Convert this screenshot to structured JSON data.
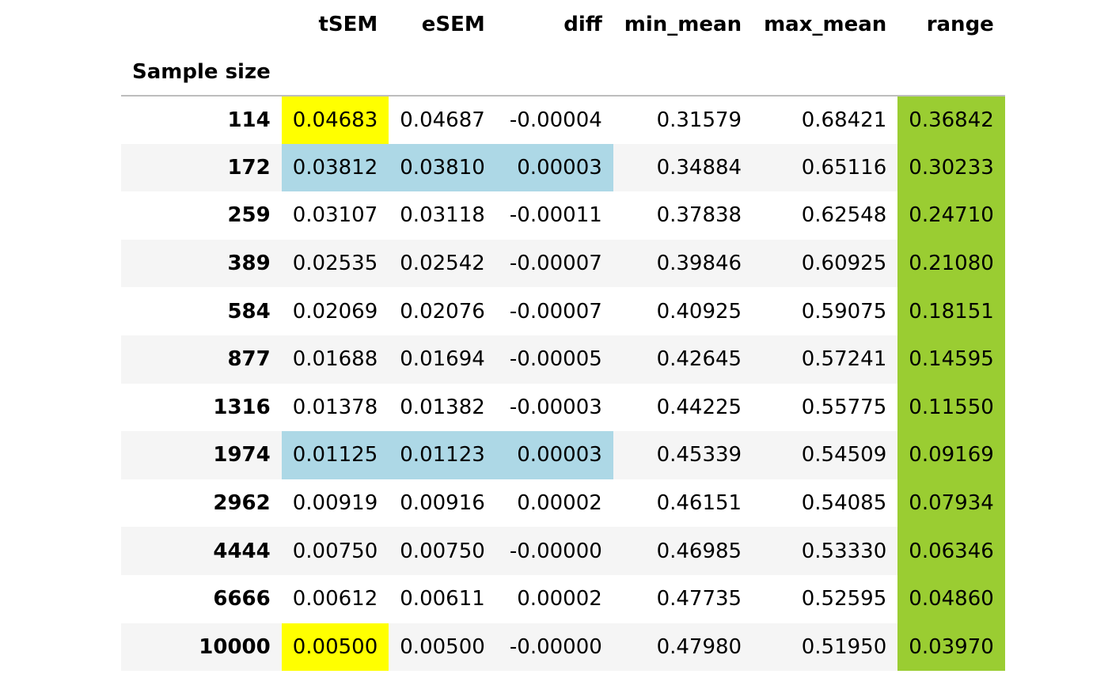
{
  "table": {
    "index_name": "Sample size",
    "columns": [
      "tSEM",
      "eSEM",
      "diff",
      "min_mean",
      "max_mean",
      "range"
    ],
    "highlight_colors": {
      "yellow": "#ffff00",
      "blue": "#add8e6",
      "green": "#9acd32"
    },
    "rows": [
      {
        "index": "114",
        "cells": [
          "0.04683",
          "0.04687",
          "-0.00004",
          "0.31579",
          "0.68421",
          "0.36842"
        ],
        "highlights": [
          "yellow",
          "",
          "",
          "",
          "",
          "green"
        ]
      },
      {
        "index": "172",
        "cells": [
          "0.03812",
          "0.03810",
          "0.00003",
          "0.34884",
          "0.65116",
          "0.30233"
        ],
        "highlights": [
          "blue",
          "blue",
          "blue",
          "",
          "",
          "green"
        ]
      },
      {
        "index": "259",
        "cells": [
          "0.03107",
          "0.03118",
          "-0.00011",
          "0.37838",
          "0.62548",
          "0.24710"
        ],
        "highlights": [
          "",
          "",
          "",
          "",
          "",
          "green"
        ]
      },
      {
        "index": "389",
        "cells": [
          "0.02535",
          "0.02542",
          "-0.00007",
          "0.39846",
          "0.60925",
          "0.21080"
        ],
        "highlights": [
          "",
          "",
          "",
          "",
          "",
          "green"
        ]
      },
      {
        "index": "584",
        "cells": [
          "0.02069",
          "0.02076",
          "-0.00007",
          "0.40925",
          "0.59075",
          "0.18151"
        ],
        "highlights": [
          "",
          "",
          "",
          "",
          "",
          "green"
        ]
      },
      {
        "index": "877",
        "cells": [
          "0.01688",
          "0.01694",
          "-0.00005",
          "0.42645",
          "0.57241",
          "0.14595"
        ],
        "highlights": [
          "",
          "",
          "",
          "",
          "",
          "green"
        ]
      },
      {
        "index": "1316",
        "cells": [
          "0.01378",
          "0.01382",
          "-0.00003",
          "0.44225",
          "0.55775",
          "0.11550"
        ],
        "highlights": [
          "",
          "",
          "",
          "",
          "",
          "green"
        ]
      },
      {
        "index": "1974",
        "cells": [
          "0.01125",
          "0.01123",
          "0.00003",
          "0.45339",
          "0.54509",
          "0.09169"
        ],
        "highlights": [
          "blue",
          "blue",
          "blue",
          "",
          "",
          "green"
        ]
      },
      {
        "index": "2962",
        "cells": [
          "0.00919",
          "0.00916",
          "0.00002",
          "0.46151",
          "0.54085",
          "0.07934"
        ],
        "highlights": [
          "",
          "",
          "",
          "",
          "",
          "green"
        ]
      },
      {
        "index": "4444",
        "cells": [
          "0.00750",
          "0.00750",
          "-0.00000",
          "0.46985",
          "0.53330",
          "0.06346"
        ],
        "highlights": [
          "",
          "",
          "",
          "",
          "",
          "green"
        ]
      },
      {
        "index": "6666",
        "cells": [
          "0.00612",
          "0.00611",
          "0.00002",
          "0.47735",
          "0.52595",
          "0.04860"
        ],
        "highlights": [
          "",
          "",
          "",
          "",
          "",
          "green"
        ]
      },
      {
        "index": "10000",
        "cells": [
          "0.00500",
          "0.00500",
          "-0.00000",
          "0.47980",
          "0.51950",
          "0.03970"
        ],
        "highlights": [
          "yellow",
          "",
          "",
          "",
          "",
          "green"
        ]
      }
    ]
  }
}
